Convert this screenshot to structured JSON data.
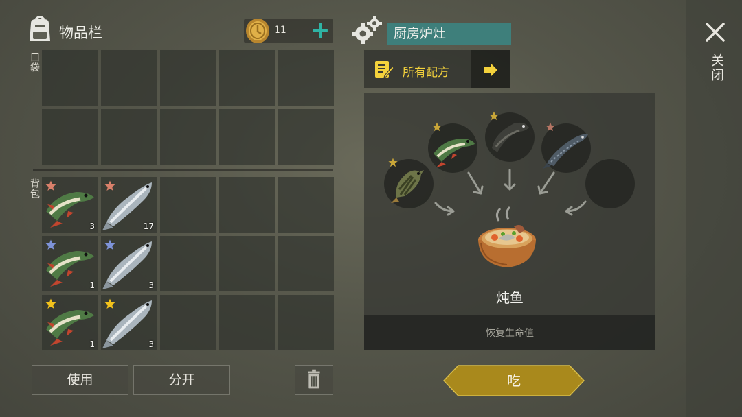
{
  "inventory": {
    "title": "物品栏",
    "coins": "11",
    "pocket_label": "口袋",
    "bag_label": "背包",
    "bag_rows": [
      [
        {
          "type": "pike",
          "star": "bronze",
          "count": "3"
        },
        {
          "type": "salmon",
          "star": "bronze",
          "count": "17"
        },
        null,
        null,
        null
      ],
      [
        {
          "type": "pike",
          "star": "silver",
          "count": "1"
        },
        {
          "type": "salmon",
          "star": "silver",
          "count": "3"
        },
        null,
        null,
        null
      ],
      [
        {
          "type": "pike",
          "star": "gold",
          "count": "1"
        },
        {
          "type": "salmon",
          "star": "gold",
          "count": "3"
        },
        null,
        null,
        null
      ]
    ]
  },
  "buttons": {
    "use": "使用",
    "split": "分开",
    "eat": "吃",
    "close": "关闭"
  },
  "crafting": {
    "station": "厨房炉灶",
    "recipes_tab": "所有配方",
    "dish_name": "炖鱼",
    "dish_effect": "恢复生命值",
    "ingredients": [
      {
        "type": "perch",
        "star": "gold"
      },
      {
        "type": "pike",
        "star": "gold"
      },
      {
        "type": "catfish",
        "star": "gold"
      },
      {
        "type": "sturgeon",
        "star": "bronze"
      },
      {
        "type": "empty",
        "star": null
      }
    ]
  },
  "colors": {
    "star_bronze": "#d9806a",
    "star_silver": "#7e93d8",
    "star_gold": "#f2c21c",
    "accent_teal": "#3e7f7b",
    "plus_teal": "#2fb3a4",
    "recipe_yellow": "#f4d23c",
    "eat_button": "#a9891c"
  },
  "icons": {
    "backpack": "backpack-icon",
    "coin": "coin-icon",
    "add": "plus-icon",
    "gear": "gear-icon",
    "recipes": "recipe-list-icon",
    "arrow": "arrow-right-icon",
    "trash": "trash-icon",
    "close": "close-icon"
  }
}
